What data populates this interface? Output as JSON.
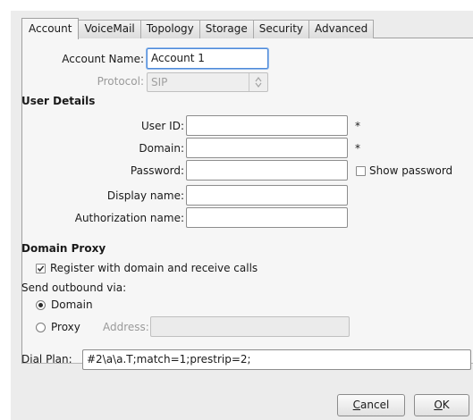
{
  "tabs": [
    "Account",
    "VoiceMail",
    "Topology",
    "Storage",
    "Security",
    "Advanced"
  ],
  "active_tab": "Account",
  "account": {
    "name_label": "Account Name:",
    "name_value": "Account 1",
    "protocol_label": "Protocol:",
    "protocol_value": "SIP"
  },
  "user_details": {
    "title": "User Details",
    "user_id_label": "User ID:",
    "user_id_value": "",
    "domain_label": "Domain:",
    "domain_value": "",
    "password_label": "Password:",
    "password_value": "",
    "display_name_label": "Display name:",
    "display_name_value": "",
    "auth_name_label": "Authorization name:",
    "auth_name_value": "",
    "required_marker": "*",
    "show_password_label": "Show password",
    "show_password_checked": false
  },
  "domain_proxy": {
    "title": "Domain Proxy",
    "register_label": "Register with domain and receive calls",
    "register_checked": true,
    "send_outbound_label": "Send outbound via:",
    "domain_option_label": "Domain",
    "proxy_option_label": "Proxy",
    "selected_option": "Domain",
    "address_label": "Address:",
    "address_value": ""
  },
  "dial_plan": {
    "label": "Dial Plan:",
    "value": "#2\\a\\a.T;match=1;prestrip=2;"
  },
  "buttons": {
    "cancel_mnemonic": "C",
    "cancel_rest": "ancel",
    "ok_mnemonic": "O",
    "ok_rest": "K"
  },
  "icons": {
    "checkmark": "checkmark-icon",
    "combo_arrows": "up-down-arrows-icon"
  },
  "colors": {
    "focus_border": "#4f8ad8",
    "dialog_background": "#ececec",
    "panel_background": "#f6f6f6"
  }
}
